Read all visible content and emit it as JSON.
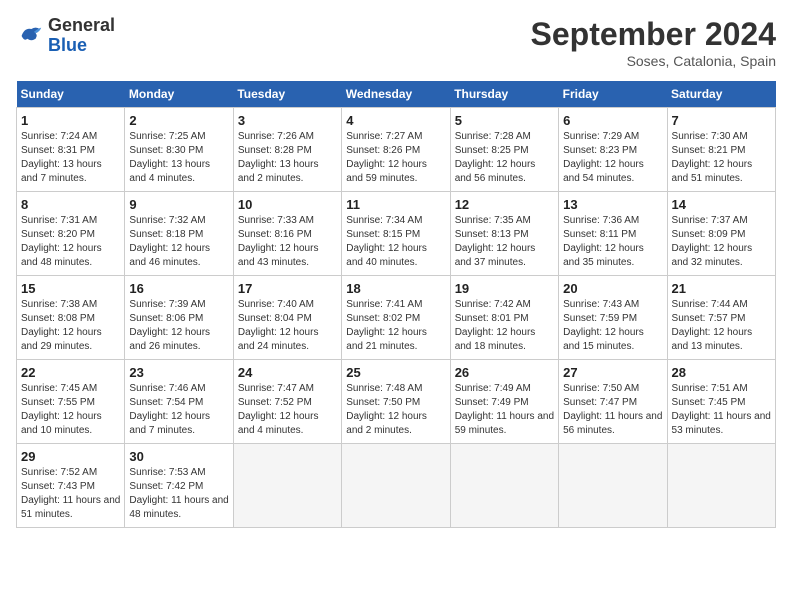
{
  "header": {
    "logo_general": "General",
    "logo_blue": "Blue",
    "month_title": "September 2024",
    "subtitle": "Soses, Catalonia, Spain"
  },
  "calendar": {
    "days_of_week": [
      "Sunday",
      "Monday",
      "Tuesday",
      "Wednesday",
      "Thursday",
      "Friday",
      "Saturday"
    ],
    "weeks": [
      [
        null,
        {
          "day": 2,
          "sunrise": "7:25 AM",
          "sunset": "8:30 PM",
          "daylight": "13 hours and 4 minutes."
        },
        {
          "day": 3,
          "sunrise": "7:26 AM",
          "sunset": "8:28 PM",
          "daylight": "13 hours and 2 minutes."
        },
        {
          "day": 4,
          "sunrise": "7:27 AM",
          "sunset": "8:26 PM",
          "daylight": "12 hours and 59 minutes."
        },
        {
          "day": 5,
          "sunrise": "7:28 AM",
          "sunset": "8:25 PM",
          "daylight": "12 hours and 56 minutes."
        },
        {
          "day": 6,
          "sunrise": "7:29 AM",
          "sunset": "8:23 PM",
          "daylight": "12 hours and 54 minutes."
        },
        {
          "day": 7,
          "sunrise": "7:30 AM",
          "sunset": "8:21 PM",
          "daylight": "12 hours and 51 minutes."
        }
      ],
      [
        {
          "day": 1,
          "sunrise": "7:24 AM",
          "sunset": "8:31 PM",
          "daylight": "13 hours and 7 minutes."
        },
        null,
        null,
        null,
        null,
        null,
        null
      ],
      [
        {
          "day": 8,
          "sunrise": "7:31 AM",
          "sunset": "8:20 PM",
          "daylight": "12 hours and 48 minutes."
        },
        {
          "day": 9,
          "sunrise": "7:32 AM",
          "sunset": "8:18 PM",
          "daylight": "12 hours and 46 minutes."
        },
        {
          "day": 10,
          "sunrise": "7:33 AM",
          "sunset": "8:16 PM",
          "daylight": "12 hours and 43 minutes."
        },
        {
          "day": 11,
          "sunrise": "7:34 AM",
          "sunset": "8:15 PM",
          "daylight": "12 hours and 40 minutes."
        },
        {
          "day": 12,
          "sunrise": "7:35 AM",
          "sunset": "8:13 PM",
          "daylight": "12 hours and 37 minutes."
        },
        {
          "day": 13,
          "sunrise": "7:36 AM",
          "sunset": "8:11 PM",
          "daylight": "12 hours and 35 minutes."
        },
        {
          "day": 14,
          "sunrise": "7:37 AM",
          "sunset": "8:09 PM",
          "daylight": "12 hours and 32 minutes."
        }
      ],
      [
        {
          "day": 15,
          "sunrise": "7:38 AM",
          "sunset": "8:08 PM",
          "daylight": "12 hours and 29 minutes."
        },
        {
          "day": 16,
          "sunrise": "7:39 AM",
          "sunset": "8:06 PM",
          "daylight": "12 hours and 26 minutes."
        },
        {
          "day": 17,
          "sunrise": "7:40 AM",
          "sunset": "8:04 PM",
          "daylight": "12 hours and 24 minutes."
        },
        {
          "day": 18,
          "sunrise": "7:41 AM",
          "sunset": "8:02 PM",
          "daylight": "12 hours and 21 minutes."
        },
        {
          "day": 19,
          "sunrise": "7:42 AM",
          "sunset": "8:01 PM",
          "daylight": "12 hours and 18 minutes."
        },
        {
          "day": 20,
          "sunrise": "7:43 AM",
          "sunset": "7:59 PM",
          "daylight": "12 hours and 15 minutes."
        },
        {
          "day": 21,
          "sunrise": "7:44 AM",
          "sunset": "7:57 PM",
          "daylight": "12 hours and 13 minutes."
        }
      ],
      [
        {
          "day": 22,
          "sunrise": "7:45 AM",
          "sunset": "7:55 PM",
          "daylight": "12 hours and 10 minutes."
        },
        {
          "day": 23,
          "sunrise": "7:46 AM",
          "sunset": "7:54 PM",
          "daylight": "12 hours and 7 minutes."
        },
        {
          "day": 24,
          "sunrise": "7:47 AM",
          "sunset": "7:52 PM",
          "daylight": "12 hours and 4 minutes."
        },
        {
          "day": 25,
          "sunrise": "7:48 AM",
          "sunset": "7:50 PM",
          "daylight": "12 hours and 2 minutes."
        },
        {
          "day": 26,
          "sunrise": "7:49 AM",
          "sunset": "7:49 PM",
          "daylight": "11 hours and 59 minutes."
        },
        {
          "day": 27,
          "sunrise": "7:50 AM",
          "sunset": "7:47 PM",
          "daylight": "11 hours and 56 minutes."
        },
        {
          "day": 28,
          "sunrise": "7:51 AM",
          "sunset": "7:45 PM",
          "daylight": "11 hours and 53 minutes."
        }
      ],
      [
        {
          "day": 29,
          "sunrise": "7:52 AM",
          "sunset": "7:43 PM",
          "daylight": "11 hours and 51 minutes."
        },
        {
          "day": 30,
          "sunrise": "7:53 AM",
          "sunset": "7:42 PM",
          "daylight": "11 hours and 48 minutes."
        },
        null,
        null,
        null,
        null,
        null
      ]
    ]
  }
}
